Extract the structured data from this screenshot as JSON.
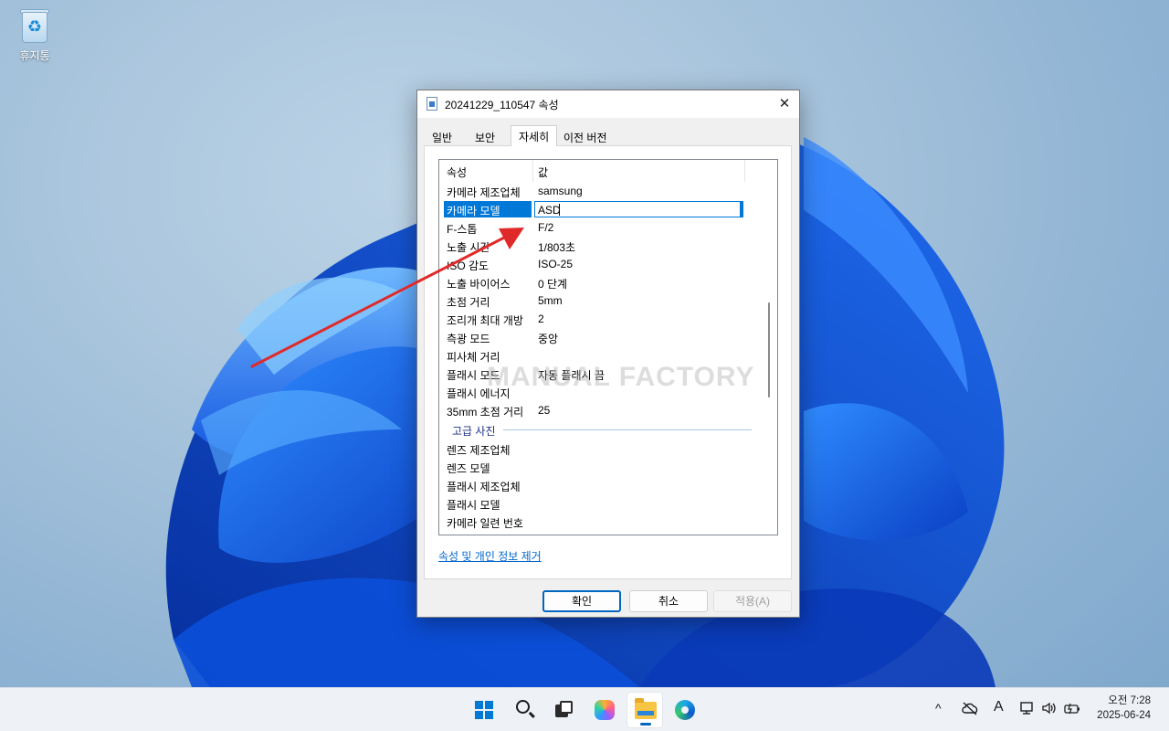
{
  "desktop": {
    "recycle_bin_label": "휴지통"
  },
  "dialog": {
    "title": "20241229_110547 속성",
    "close_glyph": "✕",
    "tabs": [
      {
        "label": "일반"
      },
      {
        "label": "보안"
      },
      {
        "label": "자세히"
      },
      {
        "label": "이전 버전"
      }
    ],
    "columns": {
      "property": "속성",
      "value": "값"
    },
    "rows": [
      {
        "k": "카메라 제조업체",
        "v": "samsung"
      },
      {
        "k": "카메라 모델",
        "v": "ASD"
      },
      {
        "k": "F-스톱",
        "v": "F/2"
      },
      {
        "k": "노출 시간",
        "v": "1/803초"
      },
      {
        "k": "ISO 감도",
        "v": "ISO-25"
      },
      {
        "k": "노출 바이어스",
        "v": "0 단계"
      },
      {
        "k": "초점 거리",
        "v": "5mm"
      },
      {
        "k": "조리개 최대 개방",
        "v": "2"
      },
      {
        "k": "측광 모드",
        "v": "중앙"
      },
      {
        "k": "피사체 거리",
        "v": ""
      },
      {
        "k": "플래시 모드",
        "v": "자동 플래시 끔"
      },
      {
        "k": "플래시 에너지",
        "v": ""
      },
      {
        "k": "35mm 초점 거리",
        "v": "25"
      }
    ],
    "group_label": "고급 사진",
    "group_rows": [
      {
        "k": "렌즈 제조업체"
      },
      {
        "k": "렌즈 모델"
      },
      {
        "k": "플래시 제조업체"
      },
      {
        "k": "플래시 모델"
      },
      {
        "k": "카메라 일련 번호"
      }
    ],
    "watermark": "MANUAL FACTORY",
    "remove_link": "속성 및 개인 정보 제거",
    "buttons": {
      "ok": "확인",
      "cancel": "취소",
      "apply": "적용(A)"
    }
  },
  "taskbar": {
    "tray": {
      "chevron": "^",
      "ime": "A"
    },
    "clock": {
      "time": "오전 7:28",
      "date": "2025-06-24"
    }
  },
  "colors": {
    "accent": "#0078d7",
    "arrow": "#e02a2a",
    "link": "#0066cc"
  }
}
